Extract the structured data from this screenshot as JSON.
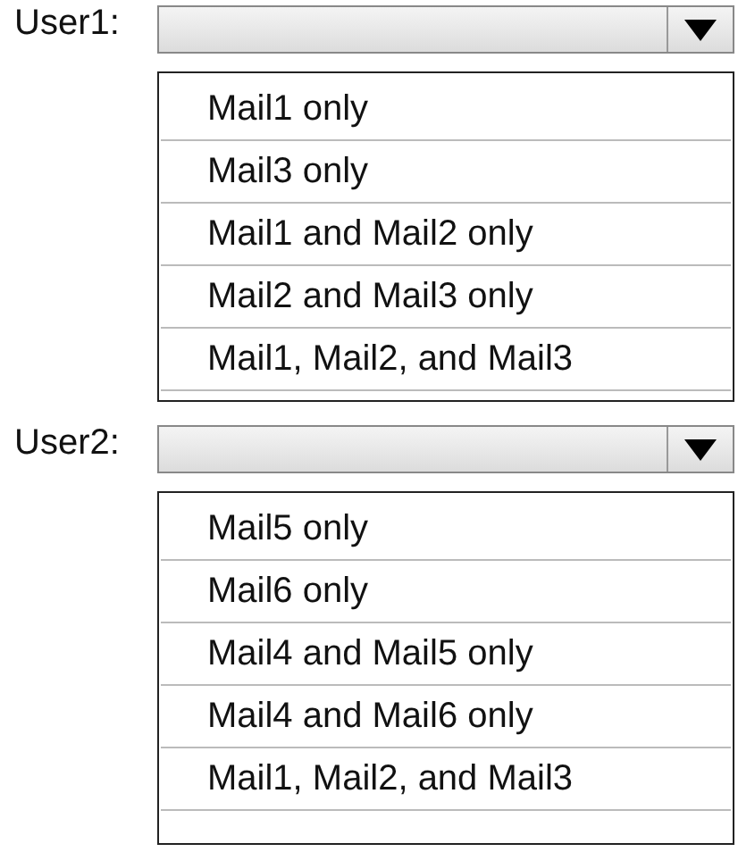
{
  "dropdowns": [
    {
      "label": "User1:",
      "options": [
        "Mail1 only",
        "Mail3 only",
        "Mail1 and Mail2 only",
        "Mail2 and Mail3 only",
        "Mail1, Mail2, and Mail3"
      ]
    },
    {
      "label": "User2:",
      "options": [
        "Mail5 only",
        "Mail6 only",
        "Mail4 and Mail5 only",
        "Mail4 and Mail6 only",
        "Mail1, Mail2, and Mail3"
      ]
    }
  ]
}
